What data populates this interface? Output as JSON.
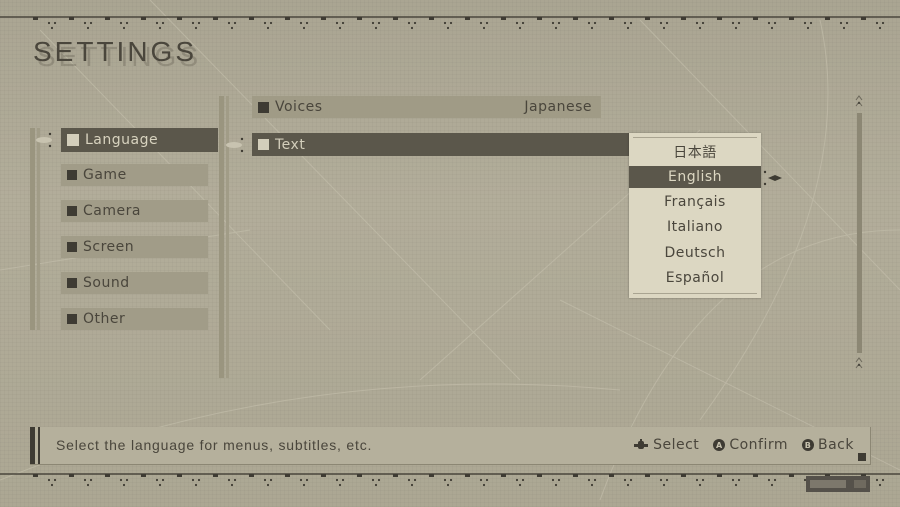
{
  "header": {
    "title": "SETTINGS"
  },
  "categories": [
    {
      "label": "Language",
      "selected": true
    },
    {
      "label": "Game",
      "selected": false
    },
    {
      "label": "Camera",
      "selected": false
    },
    {
      "label": "Screen",
      "selected": false
    },
    {
      "label": "Sound",
      "selected": false
    },
    {
      "label": "Other",
      "selected": false
    }
  ],
  "options": [
    {
      "label": "Voices",
      "value": "Japanese",
      "selected": false
    },
    {
      "label": "Text",
      "value": "English",
      "selected": true
    }
  ],
  "dropdown": {
    "items": [
      "日本語",
      "English",
      "Français",
      "Italiano",
      "Deutsch",
      "Español"
    ],
    "selected": "English"
  },
  "help": {
    "message": "Select the language for menus, subtitles, etc.",
    "controls": [
      {
        "icon": "dpad-icon",
        "label": "Select"
      },
      {
        "icon": "a-button-icon",
        "glyph": "A",
        "label": "Confirm"
      },
      {
        "icon": "b-button-icon",
        "glyph": "B",
        "label": "Back"
      }
    ]
  },
  "colors": {
    "background": "#a9a491",
    "selected": "#5b574b",
    "text_dark": "#4a463c",
    "text_light": "#d3cebb",
    "dropdown_bg": "#dcd7c2"
  }
}
